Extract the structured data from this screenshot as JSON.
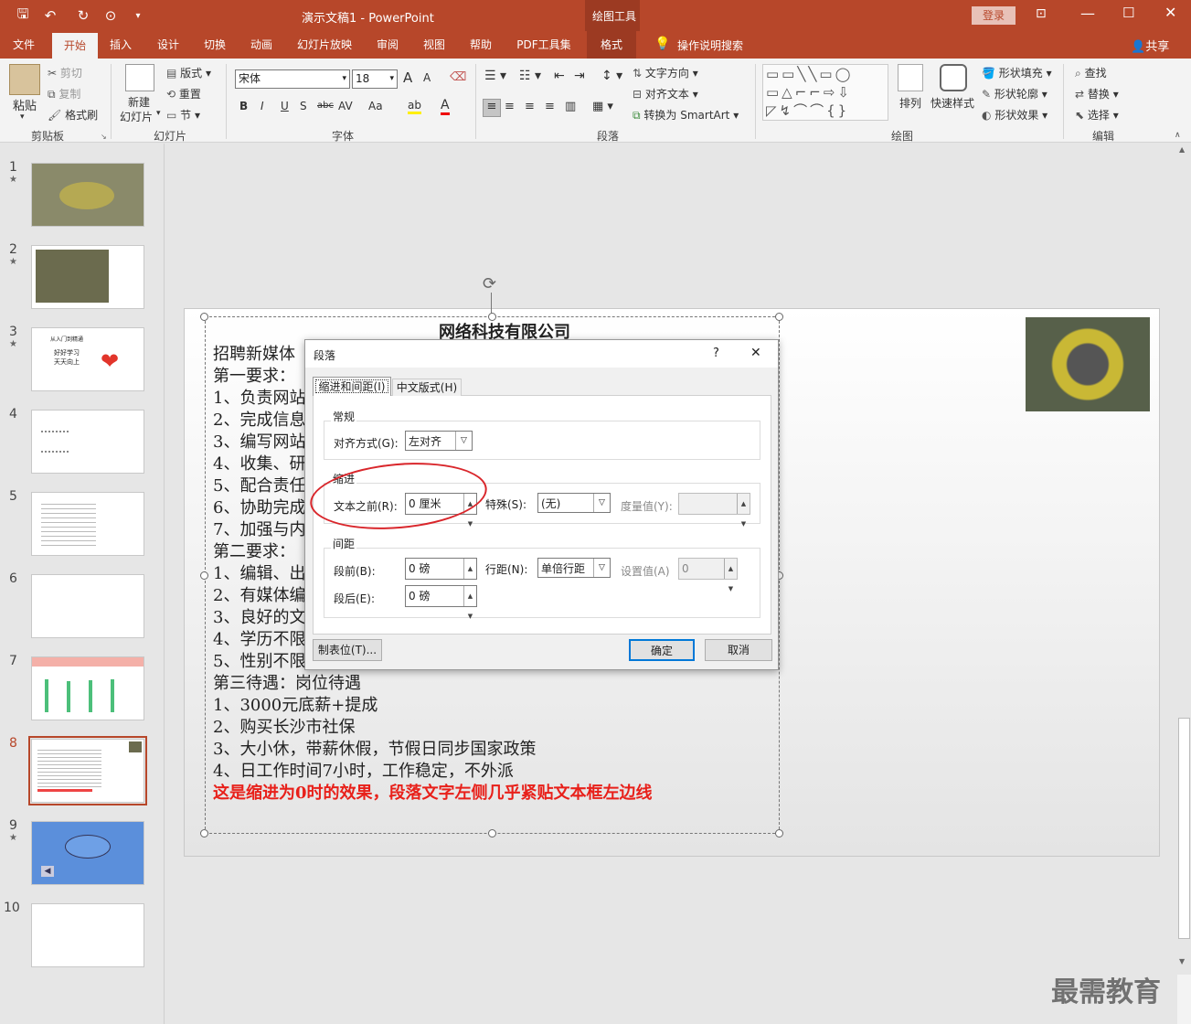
{
  "window": {
    "title": "演示文稿1  -  PowerPoint",
    "tools": "绘图工具",
    "login": "登录",
    "share": "共享",
    "tell": "操作说明搜索"
  },
  "tabs": [
    "文件",
    "开始",
    "插入",
    "设计",
    "切换",
    "动画",
    "幻灯片放映",
    "审阅",
    "视图",
    "帮助",
    "PDF工具集",
    "格式"
  ],
  "ribbon": {
    "clipboard": {
      "paste": "粘贴",
      "cut": "剪切",
      "copy": "复制",
      "painter": "格式刷",
      "label": "剪贴板"
    },
    "slides": {
      "new": "新建",
      "new2": "幻灯片",
      "layout": "版式",
      "reset": "重置",
      "section": "节",
      "label": "幻灯片"
    },
    "font": {
      "name": "宋体",
      "size": "18",
      "label": "字体",
      "b": "B",
      "i": "I",
      "u": "U",
      "s": "S",
      "abc": "abc",
      "av": "AV",
      "aa": "Aa",
      "ab": "ab",
      "a": "A",
      "ainc": "A",
      "adec": "A"
    },
    "paragraph": {
      "label": "段落",
      "textdir": "文字方向",
      "align": "对齐文本",
      "smartart": "转换为 SmartArt"
    },
    "drawing": {
      "label": "绘图",
      "arrange": "排列",
      "quick": "快速样式",
      "fill": "形状填充",
      "outline": "形状轮廓",
      "effect": "形状效果"
    },
    "editing": {
      "label": "编辑",
      "find": "查找",
      "replace": "替换",
      "select": "选择"
    }
  },
  "thumbnails": [
    {
      "num": "1",
      "star": "★"
    },
    {
      "num": "2",
      "star": "★"
    },
    {
      "num": "3",
      "star": "★",
      "t1": "从入门到精通",
      "t2": "好好学习",
      "t3": "天天向上"
    },
    {
      "num": "4",
      "star": ""
    },
    {
      "num": "5",
      "star": ""
    },
    {
      "num": "6",
      "star": ""
    },
    {
      "num": "7",
      "star": ""
    },
    {
      "num": "8",
      "star": ""
    },
    {
      "num": "9",
      "star": "★"
    },
    {
      "num": "10",
      "star": ""
    }
  ],
  "slide": {
    "title": "网络科技有限公司",
    "lines": [
      "招聘新媒体",
      "第一要求：",
      "1、负责网站",
      "2、完成信息",
      "3、编写网站",
      "4、收集、研",
      "5、配合责任",
      "6、协助完成",
      "7、加强与内",
      "第二要求：",
      "1、编辑、出",
      "2、有媒体编",
      "3、良好的文",
      "4、学历不限",
      "5、性别不限",
      "第三待遇：岗位待遇",
      "1、3000元底薪+提成",
      "2、购买长沙市社保",
      "3、大小休，带薪休假，节假日同步国家政策",
      "4、日工作时间7小时，工作稳定，不外派"
    ],
    "red": "这是缩进为0时的效果，段落文字左侧几乎紧贴文本框左边线"
  },
  "dialog": {
    "title": "段落",
    "help": "?",
    "close": "✕",
    "tab1": "缩进和间距(I)",
    "tab2": "中文版式(H)",
    "general": "常规",
    "align_label": "对齐方式(G):",
    "align_value": "左对齐",
    "indent": "缩进",
    "before_label": "文本之前(R):",
    "before_value": "0 厘米",
    "special_label": "特殊(S):",
    "special_value": "(无)",
    "by_label": "度量值(Y):",
    "by_value": "",
    "spacing": "间距",
    "sb_label": "段前(B):",
    "sb_value": "0 磅",
    "sa_label": "段后(E):",
    "sa_value": "0 磅",
    "ls_label": "行距(N):",
    "ls_value": "单倍行距",
    "at_label": "设置值(A)",
    "at_value": "0",
    "tabs_btn": "制表位(T)...",
    "ok": "确定",
    "cancel": "取消"
  },
  "watermark": "最需教育",
  "colors": {
    "accent": "#b7472a",
    "annot": "#d9262b"
  }
}
